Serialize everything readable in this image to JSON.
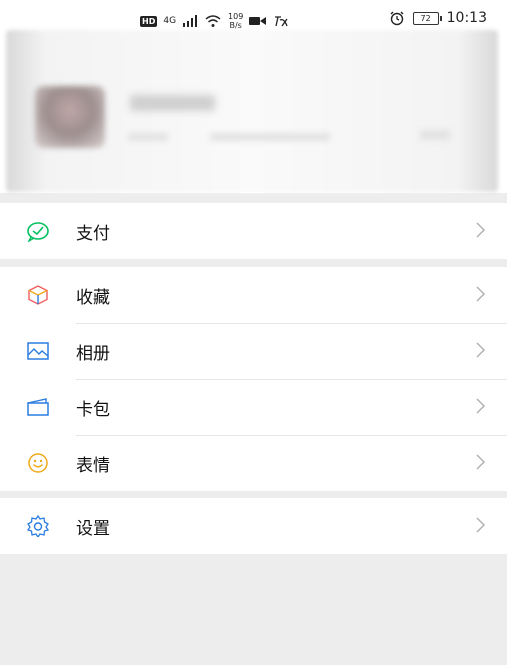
{
  "status_bar": {
    "hd": "HD",
    "network": "4G",
    "speed": "109",
    "speed_unit": "B/s",
    "battery": "72",
    "time": "10:13"
  },
  "menu": {
    "pay": "支付",
    "favorites": "收藏",
    "album": "相册",
    "wallet": "卡包",
    "stickers": "表情",
    "settings": "设置"
  },
  "colors": {
    "pay_icon": "#07c160",
    "favorites_icon": "#f25d5d",
    "album_icon": "#2b7de1",
    "wallet_icon": "#2b7de1",
    "stickers_icon": "#f0a91c",
    "settings_icon": "#2b7de1"
  }
}
